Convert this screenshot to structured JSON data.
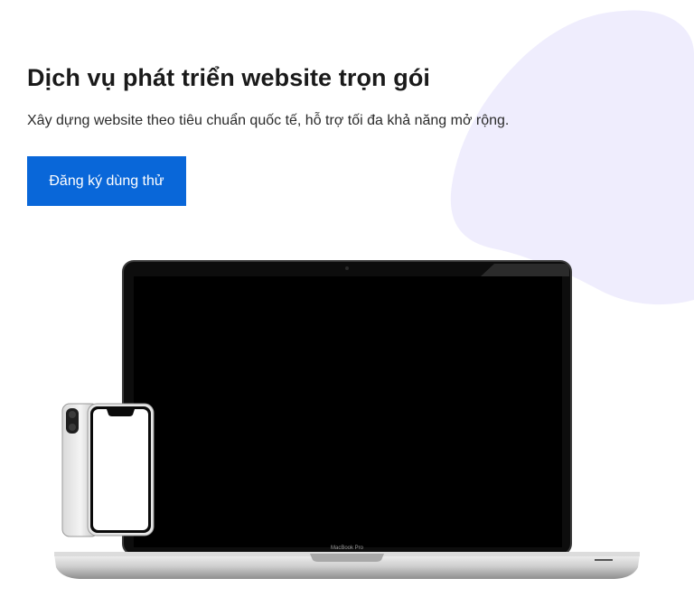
{
  "hero": {
    "title": "Dịch vụ phát triển website trọn gói",
    "subtitle": "Xây dựng website theo tiêu chuẩn quốc tế, hỗ trợ tối đa khả năng mở rộng.",
    "cta_label": "Đăng ký dùng thử"
  },
  "laptop": {
    "brand_label": "MacBook Pro"
  },
  "colors": {
    "accent": "#0967d9",
    "blob": "#efedfd",
    "text": "#1a1a1a"
  }
}
